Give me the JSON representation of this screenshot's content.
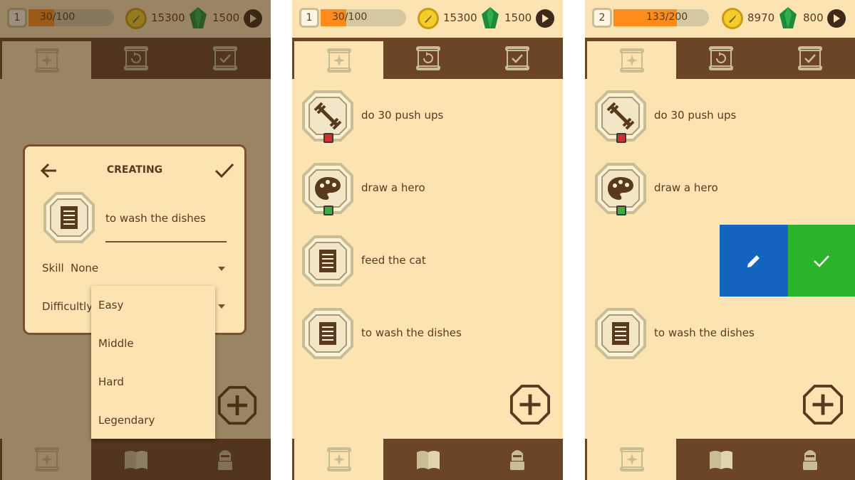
{
  "colors": {
    "accent_xp": "#ff8c1a",
    "tab_bar": "#6b4526",
    "background": "#fbe3b2",
    "edit_blue": "#1565c0",
    "done_green": "#2bb42b",
    "skill_red": "#d32f2f",
    "skill_green": "#3fae3f"
  },
  "icons": {
    "quests_tab": "scroll-compass-icon",
    "daily_tab": "scroll-repeat-icon",
    "done_tab": "scroll-check-icon",
    "tasks_nav": "scroll-compass-icon",
    "book_nav": "book-icon",
    "hero_nav": "knight-icon",
    "add": "plus-octagon-icon",
    "coin": "sword-coin-icon",
    "gem": "emerald-icon",
    "play": "play-icon"
  },
  "screens": [
    {
      "level": "1",
      "xp_text": "30/100",
      "xp_fraction": 0.3,
      "coins": "15300",
      "gems": "1500",
      "dialog": {
        "title": "CREATING",
        "task_name": "to wash the dishes",
        "skill_label": "Skill",
        "skill_value": "None",
        "difficulty_label": "Difficultly",
        "options": [
          "Easy",
          "Middle",
          "Hard",
          "Legendary"
        ]
      }
    },
    {
      "level": "1",
      "xp_text": "30/100",
      "xp_fraction": 0.3,
      "coins": "15300",
      "gems": "1500",
      "tasks": [
        {
          "label": "do 30 push ups",
          "icon": "dumbbell-icon",
          "skill_color": "red"
        },
        {
          "label": "draw a hero",
          "icon": "palette-icon",
          "skill_color": "green"
        },
        {
          "label": "feed the cat",
          "icon": "note-icon",
          "skill_color": ""
        },
        {
          "label": "to wash the dishes",
          "icon": "note-icon",
          "skill_color": ""
        }
      ]
    },
    {
      "level": "2",
      "xp_text": "133/200",
      "xp_fraction": 0.665,
      "coins": "8970",
      "gems": "800",
      "tasks": [
        {
          "label": "do 30 push ups",
          "icon": "dumbbell-icon",
          "skill_color": "red"
        },
        {
          "label": "draw a hero",
          "icon": "palette-icon",
          "skill_color": "green"
        },
        {
          "label": "to wash the dishes",
          "icon": "note-icon",
          "skill_color": ""
        }
      ],
      "swipe_actions": [
        "edit-icon",
        "check-icon"
      ]
    }
  ]
}
